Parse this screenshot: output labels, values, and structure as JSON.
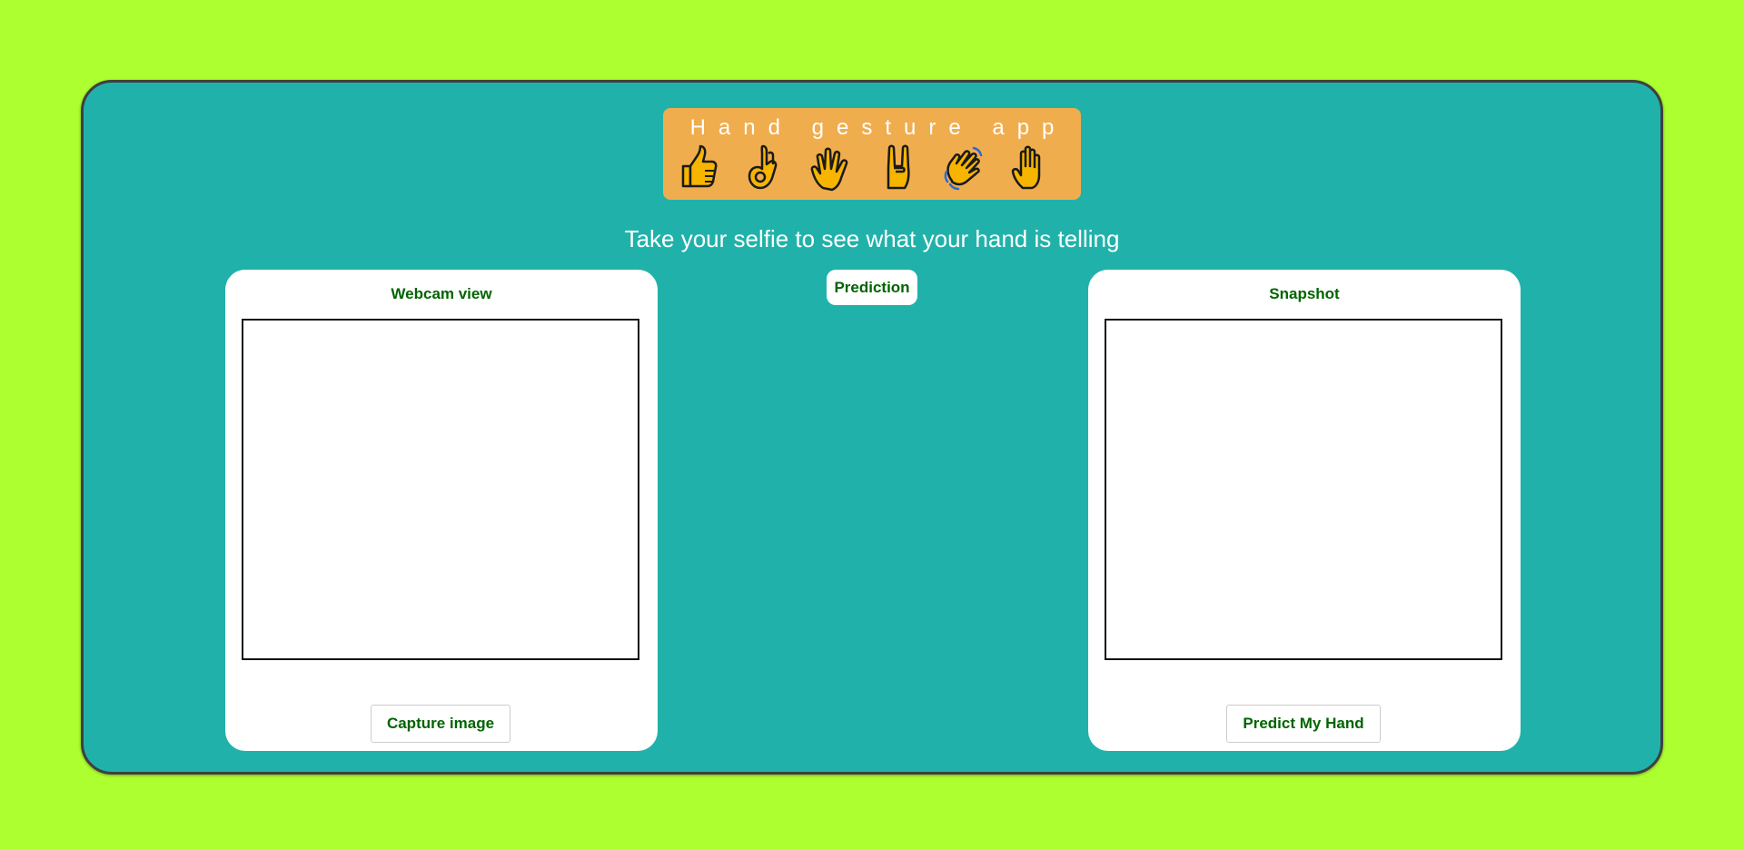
{
  "header": {
    "title": "Hand gesture app",
    "gestures": [
      "thumbs-up-icon",
      "ok-hand-icon",
      "raised-hand-fingers-splayed-icon",
      "sign-of-horns-icon",
      "waving-hand-icon",
      "raised-back-of-hand-icon"
    ]
  },
  "subtitle": "Take your selfie to see what your hand is telling",
  "webcam": {
    "title": "Webcam view",
    "button_label": "Capture image"
  },
  "prediction": {
    "label": "Prediction"
  },
  "snapshot": {
    "title": "Snapshot",
    "button_label": "Predict My Hand"
  },
  "colors": {
    "page_background": "#adff2f",
    "panel_background": "#20b2aa",
    "header_background": "#f0ad4e",
    "text_accent": "#006400"
  }
}
